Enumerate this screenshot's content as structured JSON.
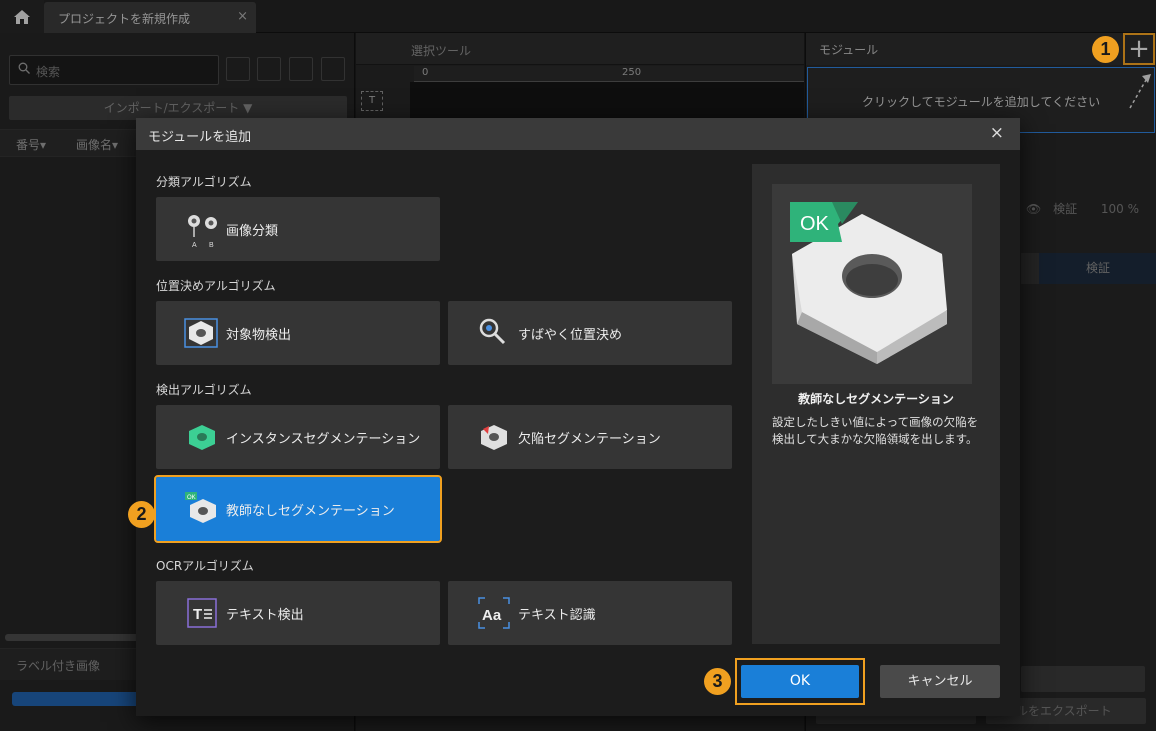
{
  "window": {
    "tab_title": "プロジェクトを新規作成",
    "tab_close": "×"
  },
  "left_panel": {
    "search_placeholder": "検索",
    "import_export_label": "インポート/エクスポート ▼",
    "columns": [
      "番号▾",
      "画像名▾"
    ],
    "labeled_images_tab": "ラベル付き画像"
  },
  "center_panel": {
    "tool_title": "選択ツール",
    "ruler_ticks": [
      "0",
      "250"
    ],
    "text_tool_icon_label": "T"
  },
  "right_panel": {
    "module_title": "モジュール",
    "add_module_symbol": "+",
    "drop_hint": "クリックしてモジュールを追加してください",
    "validate_label": "検証",
    "validate_percent": "100 %",
    "validate_tab": "検証",
    "export_label_text": "ルをエクスポート"
  },
  "badges": [
    "1",
    "2",
    "3"
  ],
  "dialog": {
    "title": "モジュールを追加",
    "close": "×",
    "sections": [
      {
        "title": "分類アルゴリズム",
        "items": [
          "画像分類"
        ]
      },
      {
        "title": "位置決めアルゴリズム",
        "items": [
          "対象物検出",
          "すばやく位置決め"
        ]
      },
      {
        "title": "検出アルゴリズム",
        "items": [
          "インスタンスセグメンテーション",
          "欠陥セグメンテーション",
          "教師なしセグメンテーション"
        ]
      },
      {
        "title": "OCRアルゴリズム",
        "items": [
          "テキスト検出",
          "テキスト認識"
        ]
      }
    ],
    "selected_item": "教師なしセグメンテーション",
    "preview": {
      "badge_text": "OK",
      "title": "教師なしセグメンテーション",
      "description": "設定したしきい値によって画像の欠陥を検出して大まかな欠陥領域を出します。"
    },
    "ok_label": "OK",
    "cancel_label": "キャンセル"
  },
  "colors": {
    "accent_blue": "#1a7fd8",
    "highlight_orange": "#f0a020",
    "ok_badge_green": "#2fb37a"
  },
  "icons": {
    "home": "home-icon",
    "search": "search-icon",
    "add": "plus-icon",
    "close": "close-icon"
  }
}
